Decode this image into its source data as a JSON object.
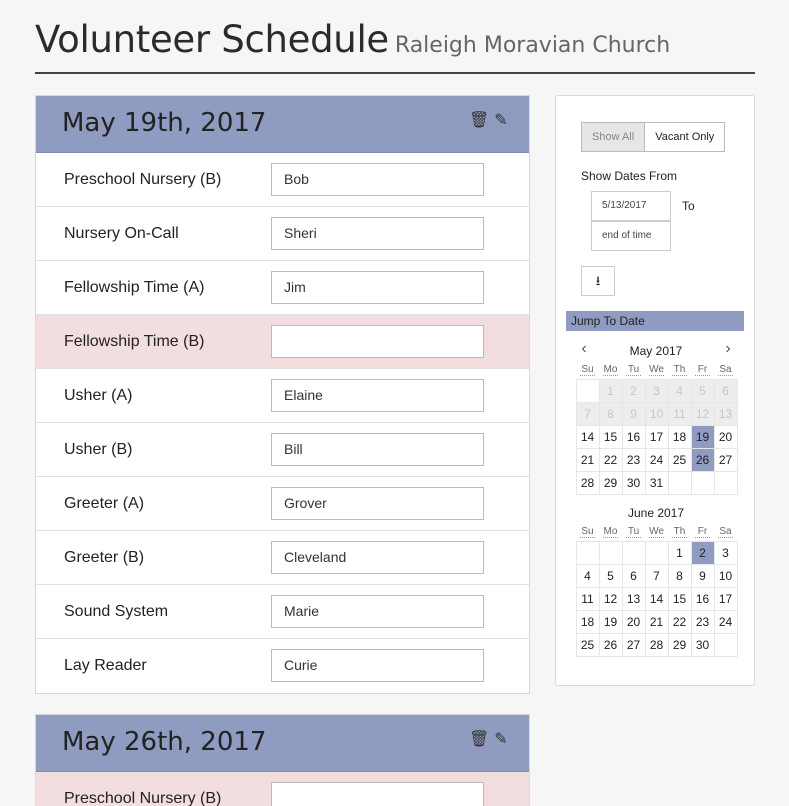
{
  "header": {
    "title": "Volunteer Schedule",
    "subtitle": "Raleigh Moravian Church"
  },
  "days": [
    {
      "date": "May 19th, 2017",
      "roles": [
        {
          "label": "Preschool Nursery (B)",
          "value": "Bob",
          "vacant": false
        },
        {
          "label": "Nursery On-Call",
          "value": "Sheri",
          "vacant": false
        },
        {
          "label": "Fellowship Time (A)",
          "value": "Jim",
          "vacant": false
        },
        {
          "label": "Fellowship Time (B)",
          "value": "",
          "vacant": true
        },
        {
          "label": "Usher (A)",
          "value": "Elaine",
          "vacant": false
        },
        {
          "label": "Usher (B)",
          "value": "Bill",
          "vacant": false
        },
        {
          "label": "Greeter (A)",
          "value": "Grover",
          "vacant": false
        },
        {
          "label": "Greeter (B)",
          "value": "Cleveland",
          "vacant": false
        },
        {
          "label": "Sound System",
          "value": "Marie",
          "vacant": false
        },
        {
          "label": "Lay Reader",
          "value": "Curie",
          "vacant": false
        }
      ]
    },
    {
      "date": "May 26th, 2017",
      "roles": [
        {
          "label": "Preschool Nursery (B)",
          "value": "",
          "vacant": true
        }
      ]
    }
  ],
  "icons": {
    "delete": "trash-icon",
    "edit": "pencil-icon",
    "download": "download-icon",
    "prev": "chevron-left-icon",
    "next": "chevron-right-icon"
  },
  "filters": {
    "show_all_label": "Show All",
    "vacant_only_label": "Vacant Only",
    "active": "Show All",
    "show_dates_from_label": "Show Dates From",
    "from_value": "5/13/2017",
    "to_label": "To",
    "to_value": "end of time"
  },
  "jump_to_date_label": "Jump To Date",
  "calendars": [
    {
      "month": "May 2017",
      "weekdays": [
        "Su",
        "Mo",
        "Tu",
        "We",
        "Th",
        "Fr",
        "Sa"
      ],
      "lead_blanks": 1,
      "days": 31,
      "disabled_through": 13,
      "selected": [
        19,
        26
      ]
    },
    {
      "month": "June 2017",
      "weekdays": [
        "Su",
        "Mo",
        "Tu",
        "We",
        "Th",
        "Fr",
        "Sa"
      ],
      "lead_blanks": 4,
      "days": 30,
      "disabled_through": 0,
      "selected": [
        2
      ]
    }
  ],
  "colors": {
    "accent": "#8f9bc0",
    "vacant": "#f2dede",
    "disabled": "#eceeee"
  }
}
